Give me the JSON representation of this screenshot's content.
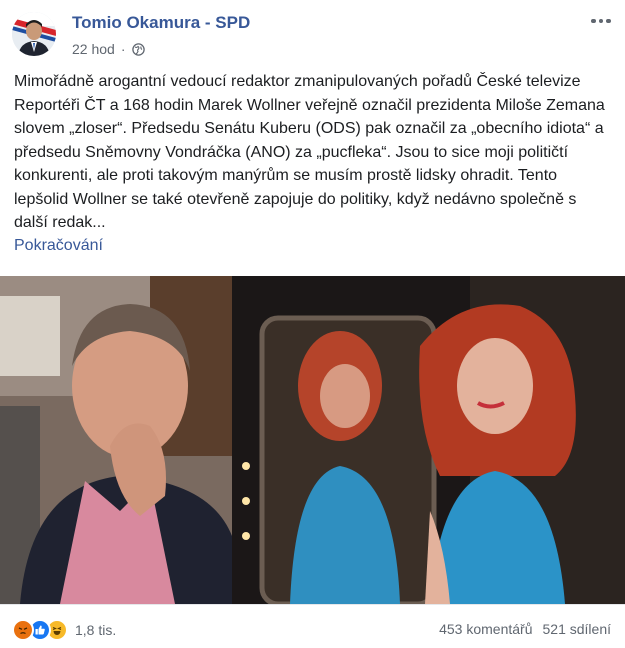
{
  "post": {
    "author": "Tomio Okamura - SPD",
    "time": "22 hod",
    "separator": "·",
    "privacy_icon": "globe-icon",
    "more_icon": "more-dots-icon",
    "text": "Mimořádně arogantní vedoucí redaktor zmanipulovaných pořadů České televize Reportéři ČT a 168 hodin Marek Wollner veřejně označil prezidenta Miloše Zemana slovem „zloser“. Předsedu Senátu Kuberu (ODS) pak označil za „obecního idiota“ a předsedu Sněmovny Vondráčka (ANO) za „pucfleka“. Jsou to sice moji političtí konkurenti, ale proti takovým manýrům se musím prostě lidsky ohradit. Tento lepšolid Wollner se také otevřeně zapojuje do politiky, když nedávno společně s další redak...",
    "see_more": "Pokračování"
  },
  "engagement": {
    "reaction_icons": [
      "angry-icon",
      "like-icon",
      "haha-icon"
    ],
    "reaction_count": "1,8 tis.",
    "comments": "453 komentářů",
    "shares": "521 sdílení"
  },
  "colors": {
    "link": "#385898",
    "meta": "#606770",
    "angry": "#e9710f",
    "like": "#1877f2",
    "haha": "#f7b928"
  }
}
